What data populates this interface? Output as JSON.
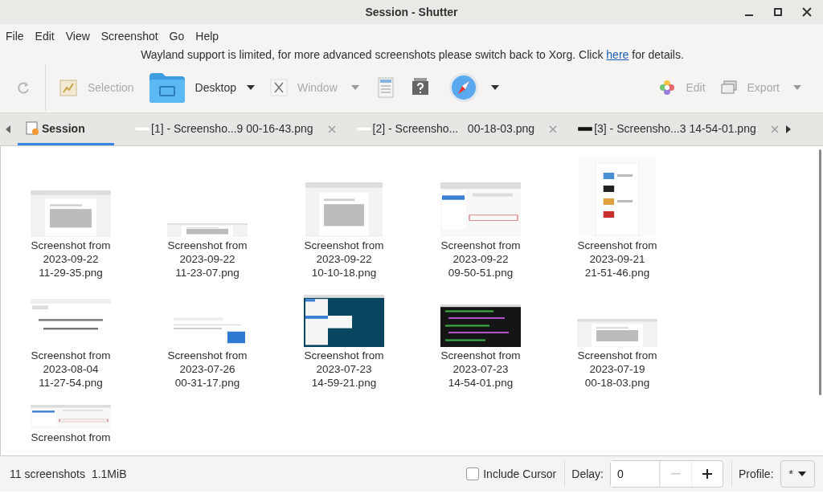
{
  "window": {
    "title": "Session - Shutter"
  },
  "menu": [
    "File",
    "Edit",
    "View",
    "Screenshot",
    "Go",
    "Help"
  ],
  "notice": {
    "before": "Wayland support is limited, for more advanced screenshots please switch back to Xorg. Click ",
    "link": "here",
    "after": " for details."
  },
  "toolbar": {
    "redo": {
      "disabled": true
    },
    "selection": {
      "label": "Selection",
      "disabled": true
    },
    "desktop": {
      "label": "Desktop",
      "disabled": false
    },
    "window": {
      "label": "Window",
      "disabled": true
    },
    "edit": {
      "label": "Edit",
      "disabled": true
    },
    "export": {
      "label": "Export",
      "disabled": true
    }
  },
  "tabs": [
    {
      "label": "Session",
      "selected": true,
      "kind": "session"
    },
    {
      "label": "[1] - Screensho...9 00-16-43.png",
      "selected": false,
      "kind": "file",
      "color": "#ffffff"
    },
    {
      "label": "[2] - Screensho...   00-18-03.png",
      "selected": false,
      "kind": "file",
      "color": "#ffffff"
    },
    {
      "label": "[3] - Screensho...3 14-54-01.png",
      "selected": false,
      "kind": "file",
      "color": "#111111"
    }
  ],
  "screenshots": [
    {
      "name": "Screenshot from\n2023-09-22\n11-29-35.png",
      "kind": "picture"
    },
    {
      "name": "Screenshot from\n2023-09-22\n11-23-07.png",
      "kind": "picture"
    },
    {
      "name": "Screenshot from\n2023-09-22\n10-10-18.png",
      "kind": "picture"
    },
    {
      "name": "Screenshot from\n2023-09-22\n09-50-51.png",
      "kind": "picture"
    },
    {
      "name": "Screenshot from\n2023-09-21\n21-51-46.png",
      "kind": "picture"
    },
    {
      "name": "Screenshot from\n2023-08-04\n11-27-54.png",
      "kind": "picture"
    },
    {
      "name": "Screenshot from\n2023-07-26\n00-31-17.png",
      "kind": "picture"
    },
    {
      "name": "Screenshot from\n2023-07-23\n14-59-21.png",
      "kind": "picture"
    },
    {
      "name": "Screenshot from\n2023-07-23\n14-54-01.png",
      "kind": "picture"
    },
    {
      "name": "Screenshot from\n2023-07-19\n00-18-03.png",
      "kind": "picture"
    },
    {
      "name": "Screenshot from",
      "kind": "picture"
    }
  ],
  "status_bar": {
    "count": "11 screenshots",
    "size": "1.1MiB",
    "include_cursor": {
      "label": "Include Cursor",
      "checked": false
    },
    "delay": {
      "label": "Delay:",
      "value": "0"
    },
    "profile": {
      "label": "Profile:",
      "value": "*"
    }
  }
}
